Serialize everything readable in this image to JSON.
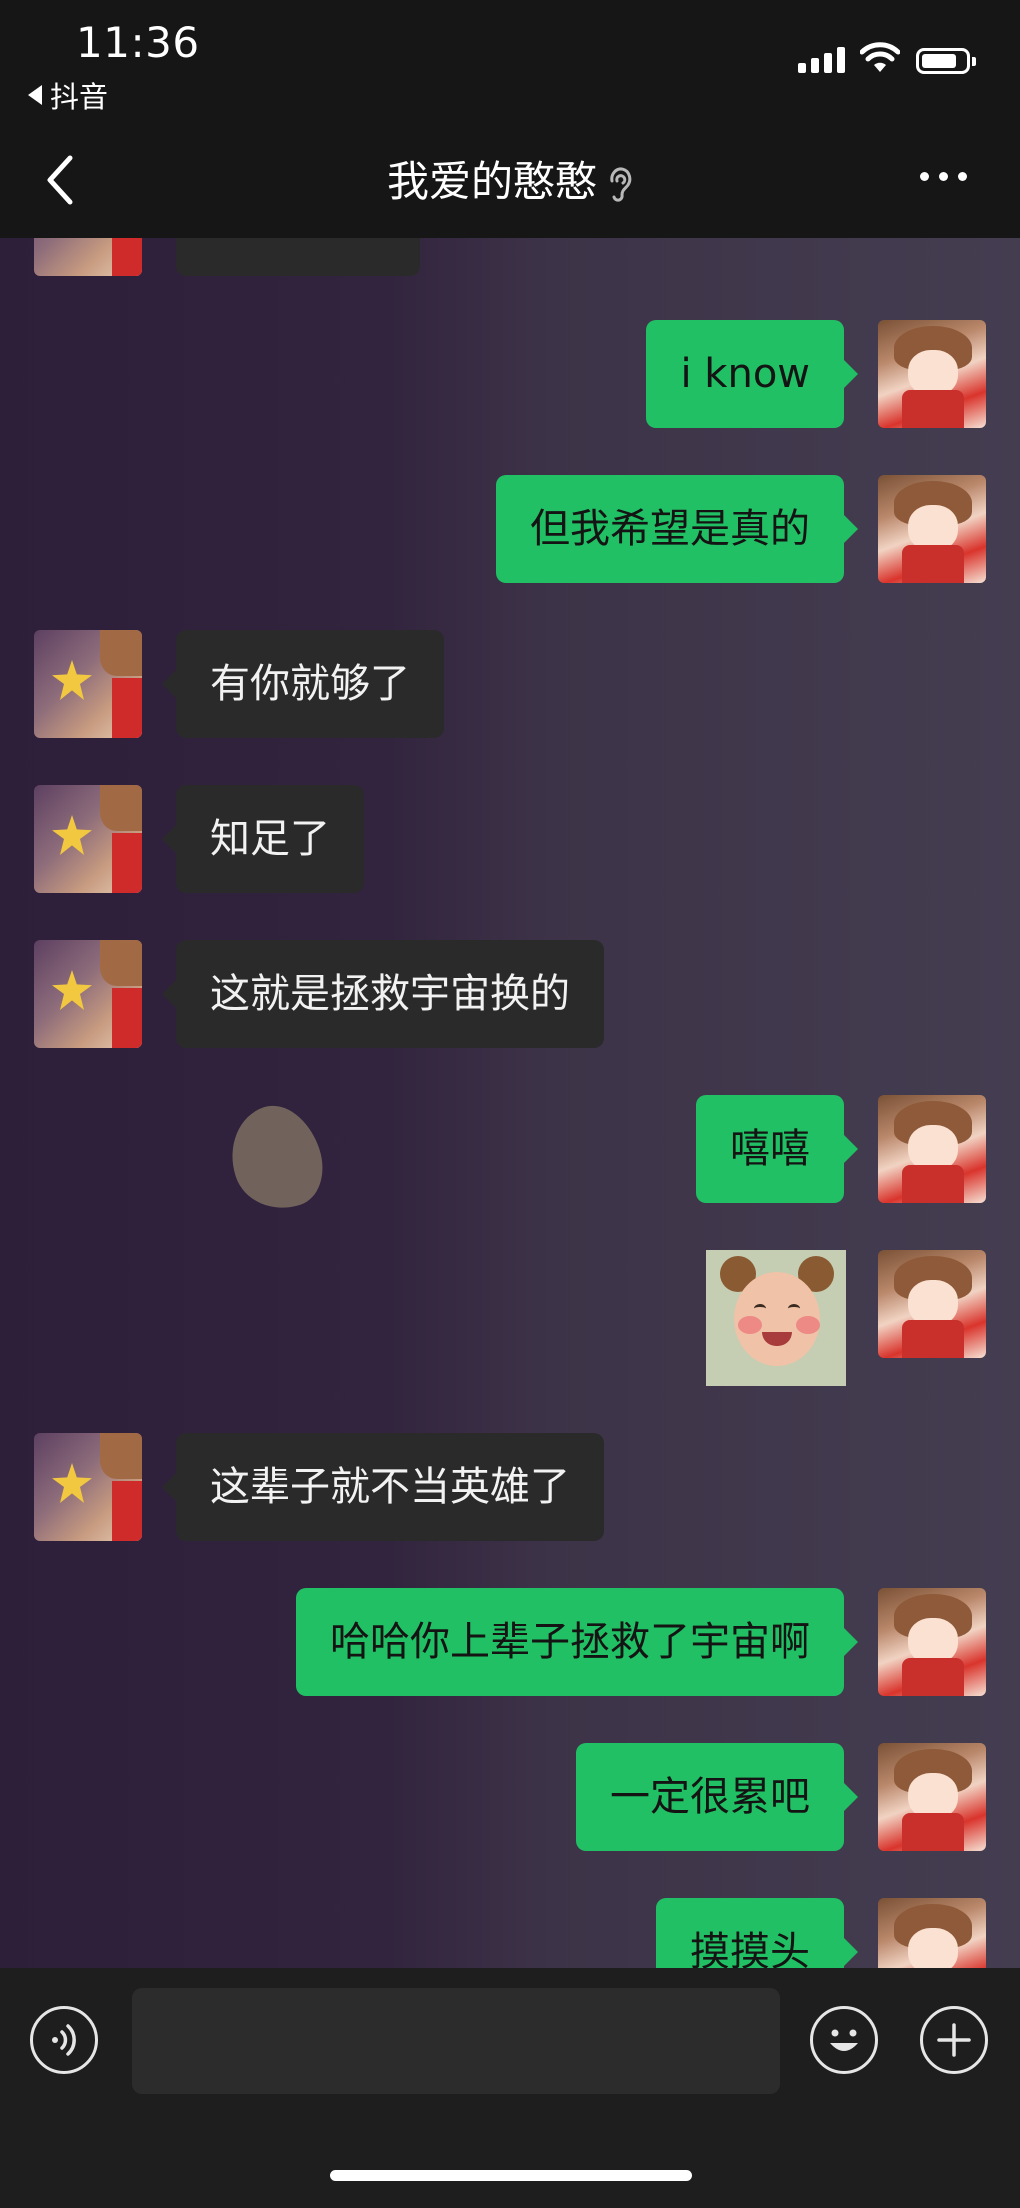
{
  "status_bar": {
    "time": "11:36",
    "back_app_label": "抖音"
  },
  "nav": {
    "title": "我爱的憨憨"
  },
  "messages": [
    {
      "side": "them",
      "text": ""
    },
    {
      "side": "me",
      "text": "i know"
    },
    {
      "side": "me",
      "text": "但我希望是真的"
    },
    {
      "side": "them",
      "text": "有你就够了"
    },
    {
      "side": "them",
      "text": "知足了"
    },
    {
      "side": "them",
      "text": "这就是拯救宇宙换的"
    },
    {
      "side": "me",
      "text": "嘻嘻"
    },
    {
      "side": "me",
      "type": "sticker",
      "sticker": "baby-bear-ears-sticker"
    },
    {
      "side": "them",
      "text": "这辈子就不当英雄了"
    },
    {
      "side": "me",
      "text": "哈哈你上辈子拯救了宇宙啊"
    },
    {
      "side": "me",
      "text": "一定很累吧"
    },
    {
      "side": "me",
      "text": "摸摸头"
    }
  ],
  "input_bar": {
    "placeholder": "",
    "icons": [
      "voice-icon",
      "emoji-icon",
      "plus-icon"
    ]
  },
  "colors": {
    "my_bubble": "#21c064",
    "their_bubble": "#2a2a2a",
    "top_bar": "#161616",
    "input_bar": "#1e1e1e"
  }
}
